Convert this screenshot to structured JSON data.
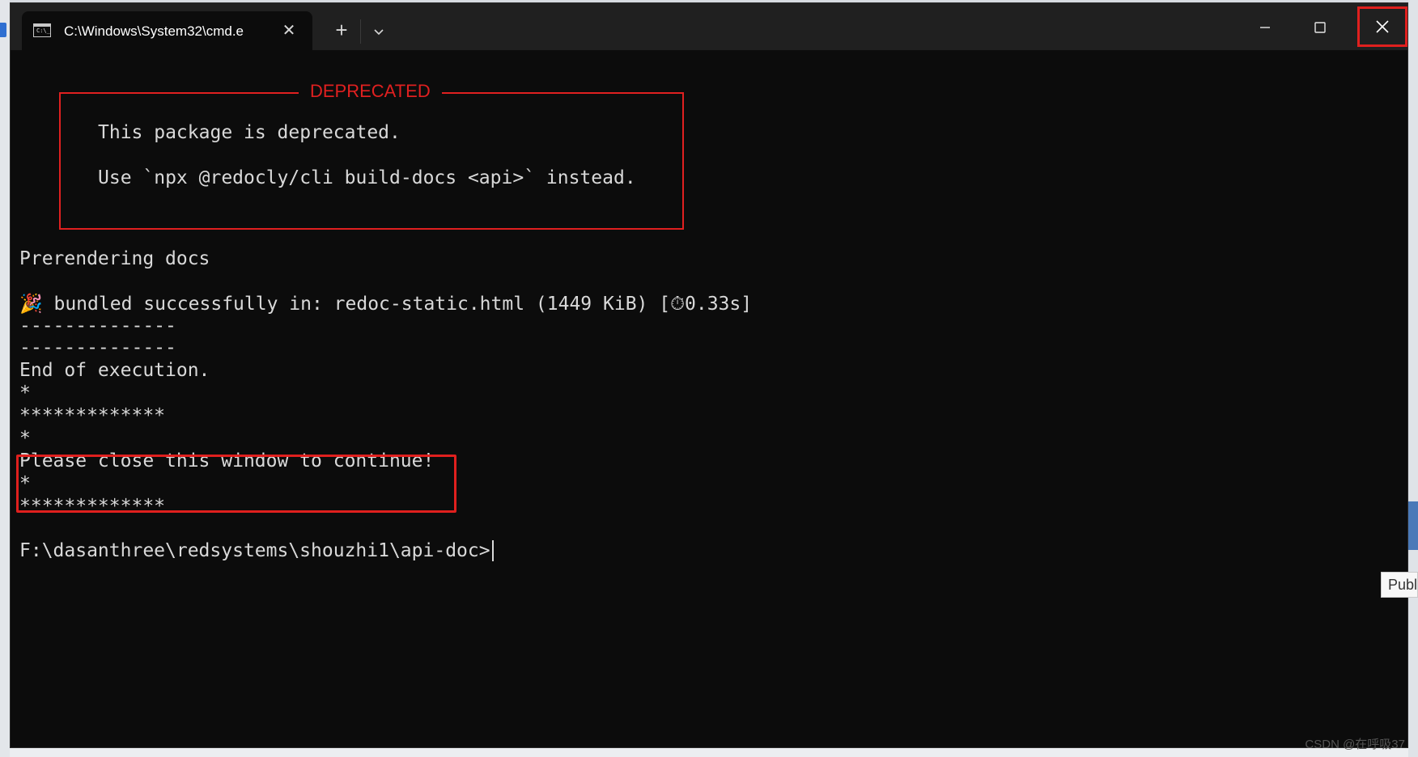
{
  "window": {
    "tab_title": "C:\\Windows\\System32\\cmd.e",
    "tab_icon_text": "C:\\_",
    "new_tab_label": "+",
    "close_tab_label": "✕"
  },
  "console": {
    "deprecated_title": "DEPRECATED",
    "deprecated_line1": "This package is deprecated.",
    "deprecated_line2": "Use `npx @redocly/cli build-docs <api>` instead.",
    "lines": [
      "Prerendering docs",
      "🎉 bundled successfully in: redoc-static.html (1449 KiB) [⏱0.33s]",
      "--------------",
      "--------------",
      "End of execution.",
      "*",
      "*************",
      "*",
      "Please close this window to continue!",
      "*",
      "*************",
      "F:\\dasanthree\\redsystems\\shouzhi1\\api-doc>"
    ]
  },
  "tooltip_text": "Publ",
  "watermark": "CSDN @在呼吸37",
  "colors": {
    "console_bg": "#0c0c0c",
    "console_text": "#d9d9d9",
    "deprecated_red": "#e02020",
    "highlight_red": "#e0201e",
    "titlebar": "#202020"
  }
}
